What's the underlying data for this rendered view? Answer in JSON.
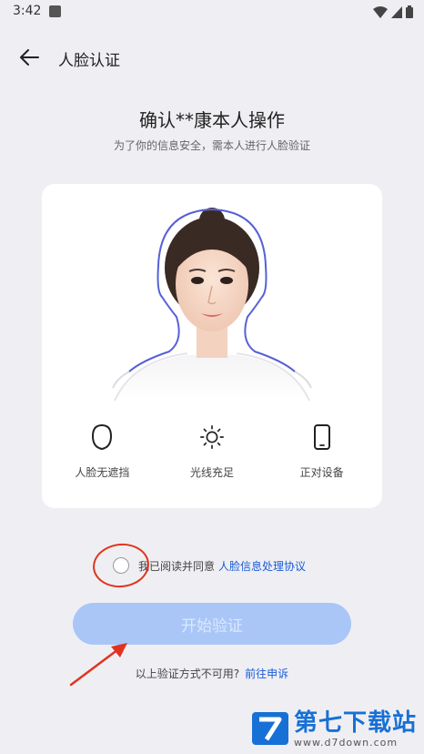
{
  "status_bar": {
    "time": "3:42"
  },
  "header": {
    "title": "人脸认证"
  },
  "main": {
    "title": "确认**康本人操作",
    "subtitle": "为了你的信息安全，需本人进行人脸验证"
  },
  "features": [
    {
      "label": "人脸无遮挡",
      "icon": "face-outline-icon"
    },
    {
      "label": "光线充足",
      "icon": "sun-icon"
    },
    {
      "label": "正对设备",
      "icon": "phone-icon"
    }
  ],
  "agreement": {
    "text": "我已阅读并同意",
    "link": "人脸信息处理协议",
    "checked": false
  },
  "start_button": {
    "label": "开始验证",
    "enabled": false
  },
  "footer": {
    "text": "以上验证方式不可用?",
    "link": "前往申诉"
  },
  "watermark": {
    "title": "第七下载站",
    "url": "www.d7down.com"
  },
  "colors": {
    "accent": "#1a5bd8",
    "button_disabled": "#a9c6f7",
    "annotation_red": "#e0331f"
  }
}
